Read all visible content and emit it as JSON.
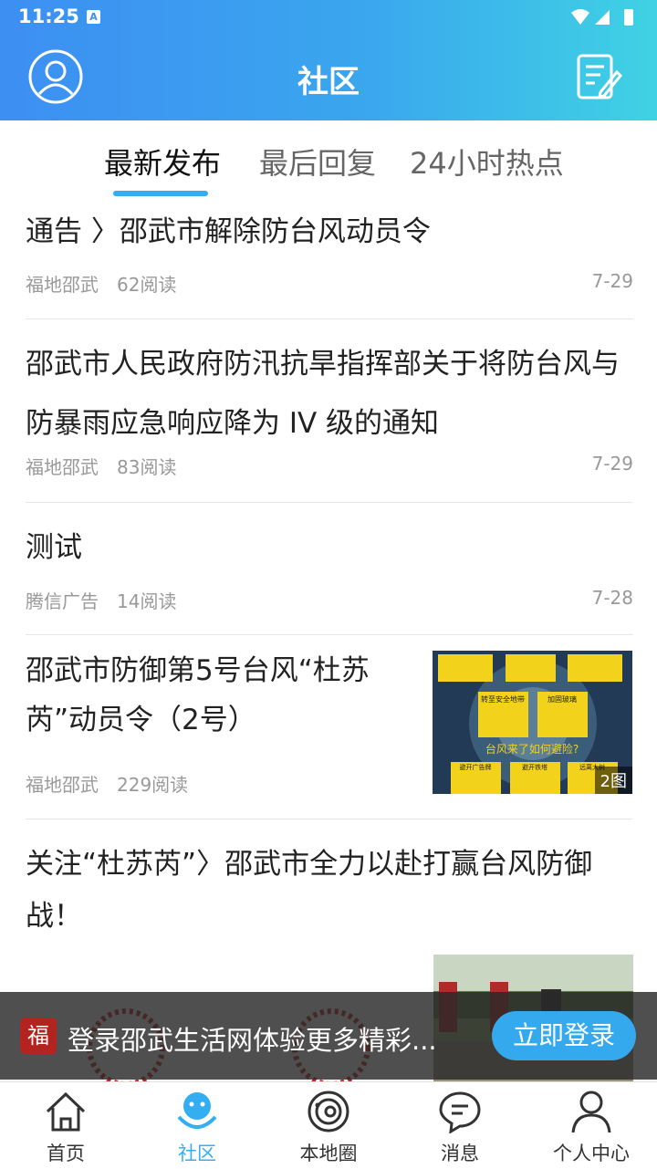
{
  "status_bar": {
    "time": "11:25",
    "notification_letter": "A"
  },
  "header": {
    "title": "社区"
  },
  "tabs": [
    {
      "label": "最新发布"
    },
    {
      "label": "最后回复"
    },
    {
      "label": "24小时热点"
    }
  ],
  "feed": [
    {
      "title": "通告 〉邵武市解除防台风动员令",
      "source": "福地邵武",
      "reads": "62阅读",
      "date": "7-29"
    },
    {
      "title_line1": "邵武市人民政府防汛抗旱指挥部关于将防台风与",
      "title_line2": "防暴雨应急响应降为 IV 级的通知",
      "source": "福地邵武",
      "reads": "83阅读",
      "date": "7-29"
    },
    {
      "title": "测试",
      "source": "腾信广告",
      "reads": "14阅读",
      "date": "7-28"
    },
    {
      "title_line1": "邵武市防御第5号台风“杜苏",
      "title_line2": "芮”动员令（2号）",
      "source": "福地邵武",
      "reads": "229阅读",
      "image_count": "2图",
      "poster_text": [
        "转至安全地带",
        "加固玻璃",
        "台风来了如何避险?",
        "避开广告牌",
        "避开铁塔",
        "远离大树"
      ]
    },
    {
      "title_line1": "关注“杜苏芮”〉邵武市全力以赴打赢台风防御",
      "title_line2": "战！"
    }
  ],
  "login_banner": {
    "logo_char": "福",
    "text": "登录邵武生活网体验更多精彩...",
    "button": "立即登录"
  },
  "bottom_nav": [
    {
      "label": "首页",
      "icon": "home-icon"
    },
    {
      "label": "社区",
      "icon": "community-icon",
      "active": true
    },
    {
      "label": "本地圈",
      "icon": "local-circle-icon"
    },
    {
      "label": "消息",
      "icon": "message-icon"
    },
    {
      "label": "个人中心",
      "icon": "profile-icon"
    }
  ],
  "colors": {
    "accent": "#33aef0",
    "header_start": "#3d8ff2",
    "header_end": "#3fd2e4"
  }
}
